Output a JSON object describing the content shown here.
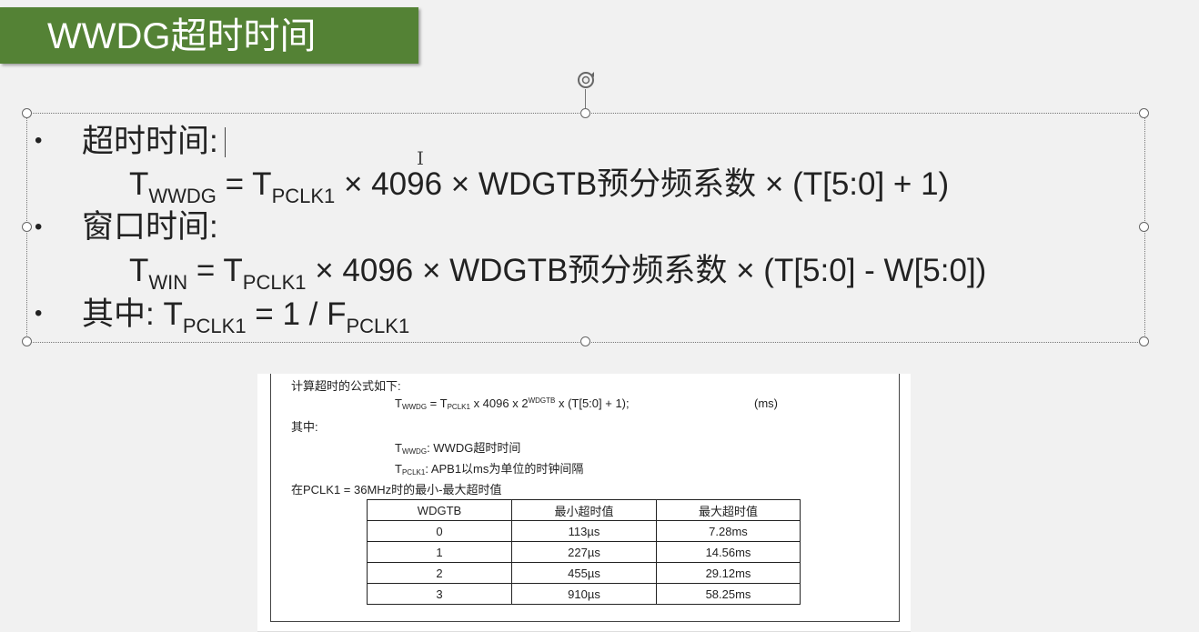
{
  "slide": {
    "title": "WWDG超时时间"
  },
  "content": {
    "bullet1": {
      "label": "超时时间:"
    },
    "formula1": {
      "lhs": "T",
      "lhs_sub": "WWDG",
      "eq": " = T",
      "pclk_sub": "PCLK1",
      "rest": " × 4096 × WDGTB预分频系数 × (T[5:0] + 1)"
    },
    "bullet2": {
      "label": "窗口时间:"
    },
    "formula2": {
      "lhs": "T",
      "lhs_sub": "WIN",
      "eq": " = T",
      "pclk_sub": "PCLK1",
      "rest": " × 4096 × WDGTB预分频系数 × (T[5:0] - W[5:0])"
    },
    "bullet3": {
      "label": "其中:",
      "t": " T",
      "t_sub": "PCLK1",
      "mid": " = 1 / F",
      "f_sub": "PCLK1"
    },
    "bullet_glyph": "•"
  },
  "doc": {
    "intro": "计算超时的公式如下:",
    "formula": {
      "t": "T",
      "t_sub": "WWDG",
      "eq": " = T",
      "pclk_sub": "PCLK1",
      "mid": " x 4096 x 2",
      "sup": "WDGTB",
      "rest": " x (T[5:0] + 1);",
      "unit": "(ms)"
    },
    "where": "其中:",
    "def1": {
      "t": "T",
      "sub": "WWDG",
      "desc": ":  WWDG超时时间"
    },
    "def2": {
      "t": "T",
      "sub": "PCLK1",
      "desc": ":  APB1以ms为单位的时钟间隔"
    },
    "table_caption": "在PCLK1 = 36MHz时的最小-最大超时值",
    "table": {
      "headers": [
        "WDGTB",
        "最小超时值",
        "最大超时值"
      ],
      "rows": [
        [
          "0",
          "113µs",
          "7.28ms"
        ],
        [
          "1",
          "227µs",
          "14.56ms"
        ],
        [
          "2",
          "455µs",
          "29.12ms"
        ],
        [
          "3",
          "910µs",
          "58.25ms"
        ]
      ]
    }
  },
  "colors": {
    "title_bg": "#548235",
    "title_text": "#ffffff"
  }
}
